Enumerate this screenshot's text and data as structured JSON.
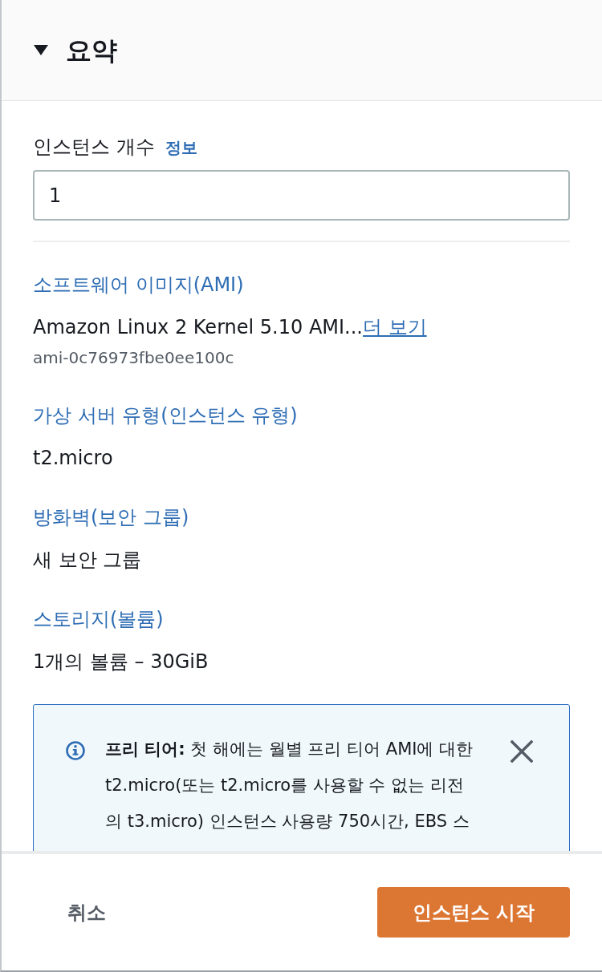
{
  "header": {
    "title": "요약",
    "expanded": true
  },
  "instance_count": {
    "label": "인스턴스 개수",
    "info_link": "정보",
    "value": "1"
  },
  "summary_items": [
    {
      "heading": "소프트웨어 이미지(AMI)",
      "value": "Amazon Linux 2 Kernel 5.10 AMI...",
      "link": "더 보기",
      "detail": "ami-0c76973fbe0ee100c"
    },
    {
      "heading": "가상 서버 유형(인스턴스 유형)",
      "value": "t2.micro"
    },
    {
      "heading": "방화벽(보안 그룹)",
      "value": "새 보안 그룹"
    },
    {
      "heading": "스토리지(볼륨)",
      "value": "1개의 볼륨 – 30GiB"
    }
  ],
  "alert": {
    "text": "**프리 티어:** 첫 해에는 월별 프리 티어 AMI에 대한 t2.micro(또는 t2.micro를 사용할 수 없는 리전의 t3.micro) 인스턴스 사용량 750시간, EBS 스"
  },
  "buttons": [
    {
      "label": "취소",
      "kind": "link"
    },
    {
      "label": "인스턴스 시작",
      "kind": "primary"
    }
  ]
}
